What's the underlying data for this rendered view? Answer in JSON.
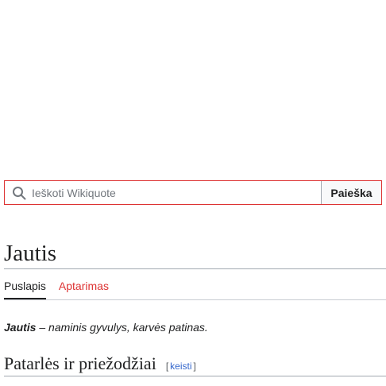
{
  "search": {
    "placeholder": "Ieškoti Wikiquote",
    "button_label": "Paieška",
    "icon": "search-icon"
  },
  "page": {
    "title": "Jautis"
  },
  "tabs": [
    {
      "label": "Puslapis",
      "active": true
    },
    {
      "label": "Aptarimas",
      "active": false
    }
  ],
  "lead": {
    "term": "Jautis",
    "definition": " – naminis gyvulys, karvės patinas."
  },
  "section": {
    "title": "Patarlės ir priežodžiai",
    "edit_open": "[",
    "edit_label": "keisti",
    "edit_close": "]"
  },
  "colors": {
    "search_border": "#dd3333",
    "link": "#3366cc",
    "new_link": "#dd3333"
  }
}
